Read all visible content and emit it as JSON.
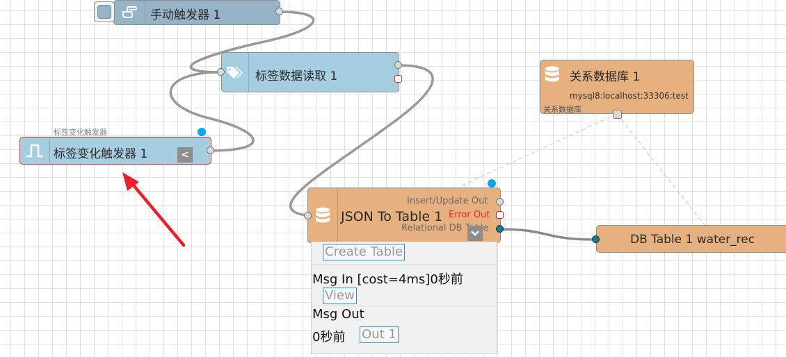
{
  "nodes": {
    "manual_trigger": {
      "label": "手动触发器 1"
    },
    "tag_read": {
      "label": "标签数据读取 1"
    },
    "tag_change_trigger": {
      "label": "标签变化触发器 1",
      "caption": "标签变化触发器"
    },
    "relational_db": {
      "label": "关系数据库 1",
      "connection": "mysql8:localhost:33306:test",
      "caption": "关系数据库"
    },
    "json_to_table": {
      "label": "JSON To Table 1",
      "port_insert_update": "Insert/Update Out",
      "port_error": "Error Out",
      "port_relational": "Relational DB Table"
    },
    "db_table": {
      "label": "DB Table 1 water_rec"
    }
  },
  "panel": {
    "create_table": "Create Table",
    "msg_in": "Msg In [cost=4ms]0秒前",
    "view": "View",
    "msg_out": "Msg Out",
    "out_time": "0秒前",
    "out_button": "Out 1"
  },
  "icons": {
    "manual_trigger": "hand-pointer-icon",
    "tag_read": "tags-icon",
    "tag_change_trigger": "pulse-wave-icon",
    "relational_db": "database-icon",
    "json_to_table": "database-icon",
    "collapse": "chevron-left-icon",
    "dropdown": "chevron-down-icon",
    "annotation": "red-arrow"
  },
  "colors": {
    "node_blue": "#a6cde0",
    "node_steel": "#97b3c8",
    "node_orange": "#e6b07f",
    "error_red": "#e0262c",
    "selection_dot": "#0aa6e8",
    "arrow_red": "#e8212b",
    "link_teal": "#0e7d91"
  }
}
